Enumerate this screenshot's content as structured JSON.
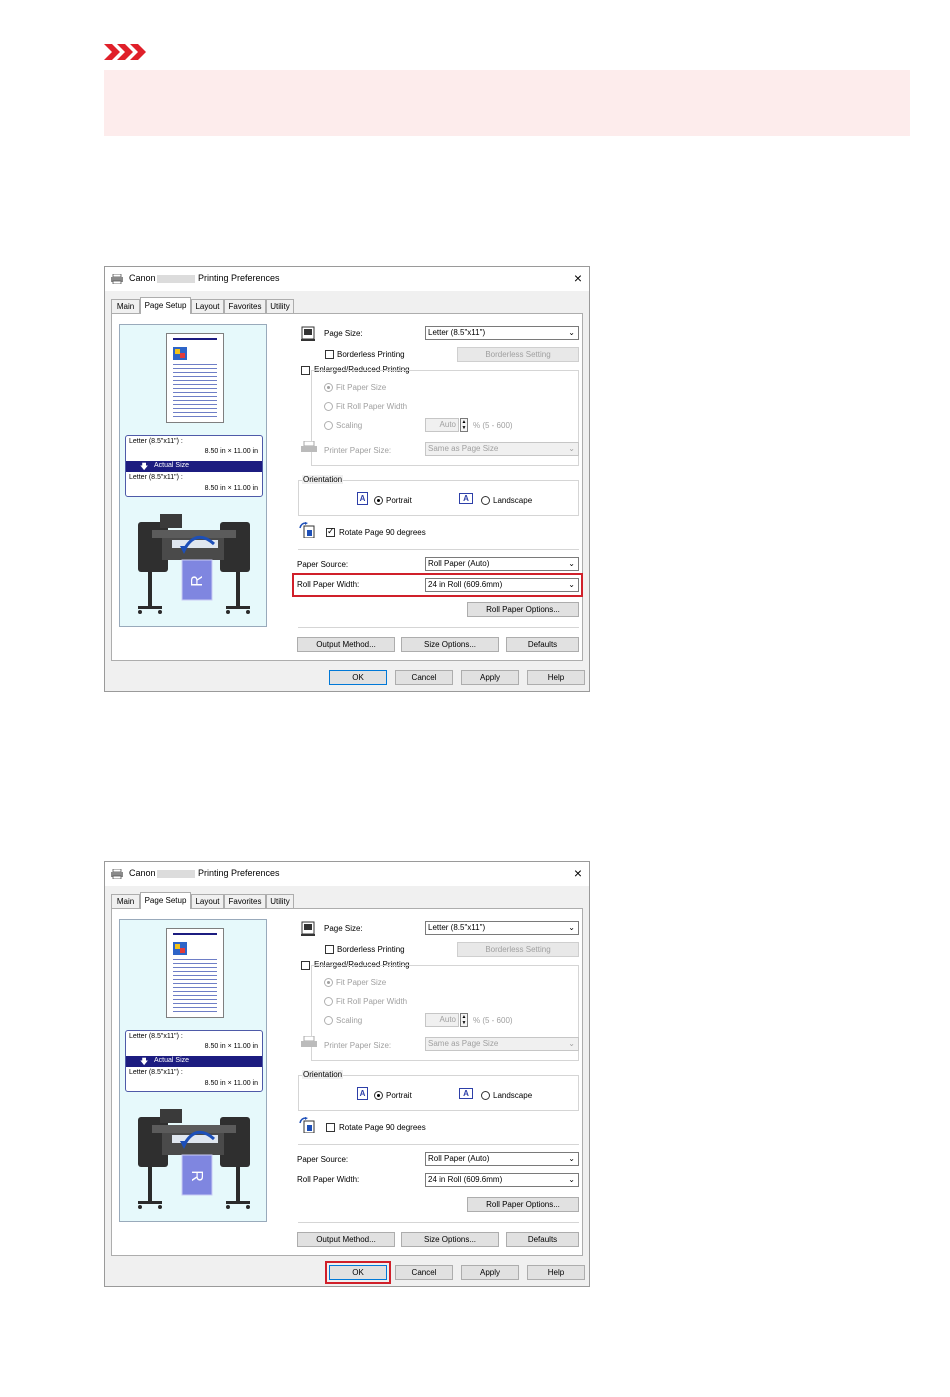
{
  "note": {
    "icon": "warning-arrows-icon",
    "accent": "#e0202a",
    "box_color": "#fdecec"
  },
  "dialogs": [
    {
      "title_prefix": "Canon",
      "title_suffix": "Printing Preferences",
      "close_label": "×",
      "tabs": [
        "Main",
        "Page Setup",
        "Layout",
        "Favorites",
        "Utility"
      ],
      "active_tab": "Page Setup",
      "preview": {
        "size_line1": "Letter (8.5\"x11\") :",
        "size_line1_dim": "8.50 in × 11.00 in",
        "actual_size": "Actual Size",
        "size_line2": "Letter (8.5\"x11\") :",
        "size_line2_dim": "8.50 in × 11.00 in"
      },
      "page_size_label": "Page Size:",
      "page_size_value": "Letter (8.5\"x11\")",
      "borderless_label": "Borderless Printing",
      "borderless_checked": false,
      "borderless_setting_button": "Borderless Setting",
      "enlarged_label": "Enlarged/Reduced Printing",
      "enlarged_checked": false,
      "fit_paper_size": "Fit Paper Size",
      "fit_roll_paper_width": "Fit Roll Paper Width",
      "scaling_label": "Scaling",
      "scaling_value": "Auto",
      "scaling_range": "% (5 - 600)",
      "printer_paper_size_label": "Printer Paper Size:",
      "printer_paper_size_value": "Same as Page Size",
      "orientation_label": "Orientation",
      "portrait_label": "Portrait",
      "landscape_label": "Landscape",
      "orientation_selected": "Portrait",
      "rotate_label": "Rotate Page 90 degrees",
      "rotate_checked": true,
      "paper_source_label": "Paper Source:",
      "paper_source_value": "Roll Paper (Auto)",
      "roll_width_label": "Roll Paper Width:",
      "roll_width_value": "24 in Roll (609.6mm)",
      "roll_options_button": "Roll Paper Options...",
      "output_method_button": "Output Method...",
      "size_options_button": "Size Options...",
      "defaults_button": "Defaults",
      "ok_button": "OK",
      "cancel_button": "Cancel",
      "apply_button": "Apply",
      "help_button": "Help",
      "highlight": "roll-paper-width",
      "highlight_color": "#d0202a"
    },
    {
      "title_prefix": "Canon",
      "title_suffix": "Printing Preferences",
      "close_label": "×",
      "tabs": [
        "Main",
        "Page Setup",
        "Layout",
        "Favorites",
        "Utility"
      ],
      "active_tab": "Page Setup",
      "preview": {
        "size_line1": "Letter (8.5\"x11\") :",
        "size_line1_dim": "8.50 in × 11.00 in",
        "actual_size": "Actual Size",
        "size_line2": "Letter (8.5\"x11\") :",
        "size_line2_dim": "8.50 in × 11.00 in"
      },
      "page_size_label": "Page Size:",
      "page_size_value": "Letter (8.5\"x11\")",
      "borderless_label": "Borderless Printing",
      "borderless_checked": false,
      "borderless_setting_button": "Borderless Setting",
      "enlarged_label": "Enlarged/Reduced Printing",
      "enlarged_checked": false,
      "fit_paper_size": "Fit Paper Size",
      "fit_roll_paper_width": "Fit Roll Paper Width",
      "scaling_label": "Scaling",
      "scaling_value": "Auto",
      "scaling_range": "% (5 - 600)",
      "printer_paper_size_label": "Printer Paper Size:",
      "printer_paper_size_value": "Same as Page Size",
      "orientation_label": "Orientation",
      "portrait_label": "Portrait",
      "landscape_label": "Landscape",
      "orientation_selected": "Portrait",
      "rotate_label": "Rotate Page 90 degrees",
      "rotate_checked": false,
      "paper_source_label": "Paper Source:",
      "paper_source_value": "Roll Paper (Auto)",
      "roll_width_label": "Roll Paper Width:",
      "roll_width_value": "24 in Roll (609.6mm)",
      "roll_options_button": "Roll Paper Options...",
      "output_method_button": "Output Method...",
      "size_options_button": "Size Options...",
      "defaults_button": "Defaults",
      "ok_button": "OK",
      "cancel_button": "Cancel",
      "apply_button": "Apply",
      "help_button": "Help",
      "highlight": "ok-button",
      "highlight_color": "#d0202a"
    }
  ]
}
